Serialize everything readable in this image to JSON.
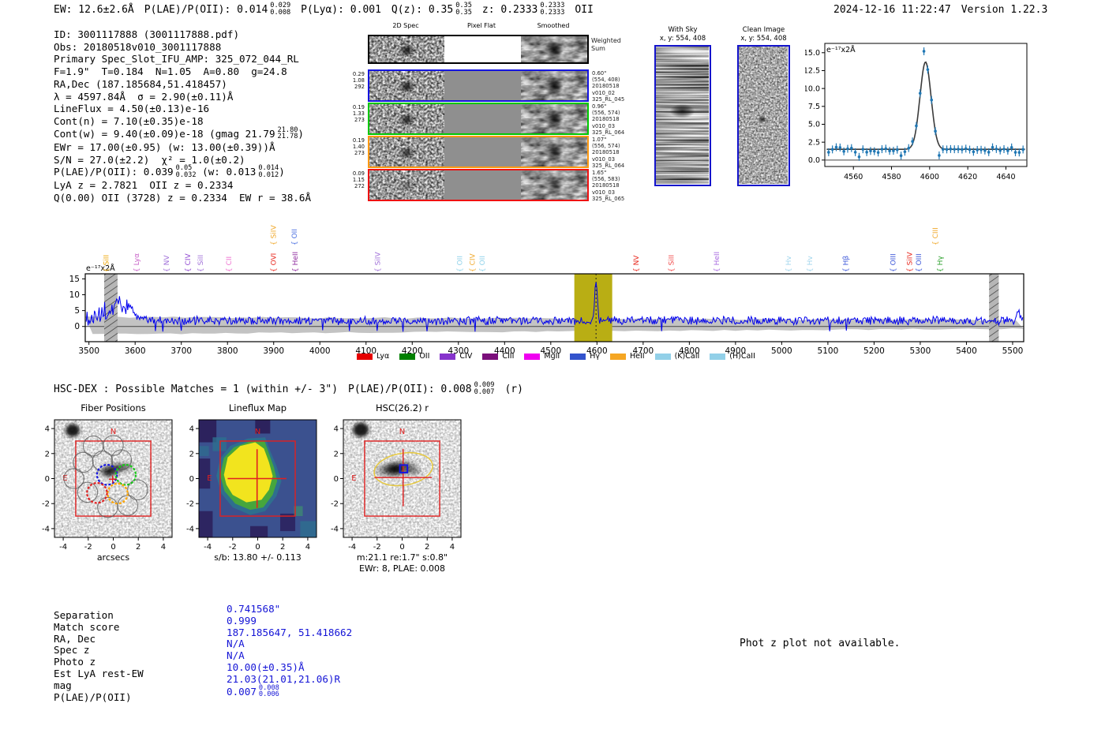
{
  "meta": {
    "datetime": "2024-12-16 11:22:47",
    "version_label": "Version 1.22.3"
  },
  "header": {
    "segments": [
      {
        "t": "EW: 12.6±2.6Å"
      },
      {
        "t": "P(LAE)/P(OII): 0.014",
        "sup": "0.029",
        "sub": "0.008"
      },
      {
        "t": "P(Lyα): 0.001"
      },
      {
        "t": "Q(z): 0.35",
        "sup": "0.35",
        "sub": "0.35"
      },
      {
        "t": "z: 0.2333",
        "sup": "0.2333",
        "sub": "0.2333"
      },
      {
        "t": "OII"
      }
    ]
  },
  "info_block": {
    "lines": [
      [
        {
          "t": "ID: 3001117888 (3001117888.pdf)"
        }
      ],
      [
        {
          "t": "Obs: 20180518v010_3001117888"
        }
      ],
      [
        {
          "t": "Primary Spec_Slot_IFU_AMP: 325_072_044_RL"
        }
      ],
      [
        {
          "t": "F=1.9\"  T=0.184  N=1.05  A=0.80  g=24.8"
        }
      ],
      [
        {
          "t": "RA,Dec (187.185684,51.418457)"
        }
      ],
      [
        {
          "t": "λ = 4597.84Å  σ = 2.90(±0.11)Å"
        }
      ],
      [
        {
          "t": "LineFlux = 4.50(±0.13)e-16"
        }
      ],
      [
        {
          "t": "Cont(n) = 7.10(±0.35)e-18"
        }
      ],
      [
        {
          "t": "Cont(w) = 9.40(±0.09)e-18 (gmag 21.79",
          "sup": "21.80",
          "sub": "21.78"
        },
        {
          "t": ")"
        }
      ],
      [
        {
          "t": "EWr = 17.00(±0.95) (w: 13.00(±0.39))Å"
        }
      ],
      [
        {
          "t": "S/N = 27.0(±2.2)  χ² = 1.0(±0.2)"
        }
      ],
      [
        {
          "t": "P(LAE)/P(OII): 0.039",
          "sup": "0.05",
          "sub": "0.032"
        },
        {
          "t": " (w: 0.013",
          "sup": "0.014",
          "sub": "0.012"
        },
        {
          "t": ")"
        }
      ],
      [
        {
          "t": "LyA z = 2.7821  OII z = 0.2334"
        }
      ],
      [
        {
          "t": "Q(0.00) OII (3728) z = 0.2334  EW r = 38.6Å"
        }
      ]
    ]
  },
  "spec2d": {
    "titles": [
      "2D Spec",
      "Pixel Flat",
      "Smoothed"
    ],
    "weighted_sum_label": "Weighted\nSum",
    "rows": [
      {
        "border": "#000000",
        "left": "",
        "right": "",
        "blob": 0.9,
        "blob_sm": 0.95,
        "flat": "#ffffff"
      },
      {
        "border": "#1414e0",
        "left": "0.29\n1.08\n292",
        "right": "0.60\"\n(554, 408)\n20180518\nv010_02\n325_RL_045",
        "blob": 0.9,
        "blob_sm": 0.95,
        "flat": "#8f8f8f"
      },
      {
        "border": "#00c800",
        "left": "0.19\n1.33\n273",
        "right": "0.96\"\n(556, 574)\n20180518\nv010_03\n325_RL_064",
        "blob": 0.85,
        "blob_sm": 0.9,
        "flat": "#8f8f8f"
      },
      {
        "border": "#ff9912",
        "left": "0.19\n1.40\n273",
        "right": "1.07\"\n(556, 574)\n20180518\nv010_03\n325_RL_064",
        "blob": 0.75,
        "blob_sm": 0.8,
        "flat": "#8f8f8f"
      },
      {
        "border": "#ee1111",
        "left": "0.09\n1.15\n272",
        "right": "1.65\"\n(556, 583)\n20180518\nv010_03\n325_RL_065",
        "blob": 0.35,
        "blob_sm": 0.55,
        "flat": "#8f8f8f"
      }
    ]
  },
  "sky_panels": {
    "with_sky": {
      "title": "With Sky",
      "subtitle": "x, y: 554, 408"
    },
    "clean": {
      "title": "Clean Image",
      "subtitle": "x, y: 554, 408"
    }
  },
  "hsc_dex": {
    "segments": [
      {
        "t": "HSC-DEX : Possible Matches = 1 (within +/- 3\")"
      },
      {
        "t": "P(LAE)/P(OII): 0.008",
        "sup": "0.009",
        "sub": "0.007"
      },
      {
        "t": "(r)"
      }
    ]
  },
  "spectrum_legend": [
    {
      "label": "Lyα",
      "color": "#e60000"
    },
    {
      "label": "OII",
      "color": "#008000"
    },
    {
      "label": "CIV",
      "color": "#8633cc"
    },
    {
      "label": "CIII",
      "color": "#7b0f7b"
    },
    {
      "label": "MgII",
      "color": "#f000f0"
    },
    {
      "label": "Hγ",
      "color": "#3353cc"
    },
    {
      "label": "HeII",
      "color": "#f5a623"
    },
    {
      "label": "(K)CaII",
      "color": "#92d0e8"
    },
    {
      "label": "(H)CaII",
      "color": "#92d0e8"
    }
  ],
  "match_table": {
    "rows": [
      {
        "label": "Separation",
        "value": "0.741568\""
      },
      {
        "label": "Match score",
        "value": "0.999"
      },
      {
        "label": "RA, Dec",
        "value": "187.185647, 51.418662"
      },
      {
        "label": "Spec z",
        "value": "N/A"
      },
      {
        "label": "Photo z",
        "value": "N/A"
      },
      {
        "label": "Est LyA rest-EW",
        "value": "10.00(±0.35)Å"
      },
      {
        "label": "mag",
        "value": "21.03(21.01,21.06)R"
      },
      {
        "label": "P(LAE)/P(OII)",
        "value": "0.007",
        "sup": "0.008",
        "sub": "0.006"
      }
    ]
  },
  "footer_note": "Phot z plot not available.",
  "chart_data": [
    {
      "id": "line_fit",
      "type": "scatter+line",
      "unit_label": "e⁻¹⁷x2Å",
      "xlim": [
        4545,
        4651
      ],
      "ylim": [
        -0.9,
        16.3
      ],
      "x_ticks": [
        4560,
        4580,
        4600,
        4620,
        4640
      ],
      "y_ticks": [
        0.0,
        2.5,
        5.0,
        7.5,
        10.0,
        12.5,
        15.0
      ],
      "fit": {
        "center": 4597.84,
        "sigma": 2.9,
        "amplitude": 12.2,
        "baseline": 1.5
      },
      "points": {
        "start": 4547,
        "end": 4649,
        "step": 2,
        "baseline": 1.5,
        "noise": 0.45,
        "errorbar": 0.55
      },
      "outliers": [
        [
          4563,
          0.45
        ],
        [
          4585,
          0.62
        ],
        [
          4605,
          0.65
        ],
        [
          4597,
          15.2
        ]
      ],
      "colors": {
        "points": "#1f77b4",
        "fit": "#3a3a3a"
      }
    },
    {
      "id": "full_spectrum",
      "type": "line",
      "unit_label": "e⁻¹⁷x2Å",
      "xlim": [
        3492,
        5524
      ],
      "ylim": [
        -4.8,
        16.6
      ],
      "x_ticks": [
        3500,
        3600,
        3700,
        3800,
        3900,
        4000,
        4100,
        4200,
        4300,
        4400,
        4500,
        4600,
        4700,
        4800,
        4900,
        5000,
        5100,
        5200,
        5300,
        5400,
        5500
      ],
      "y_ticks": [
        0,
        5,
        10,
        15
      ],
      "baseline": 1.8,
      "emission_peak": {
        "center": 4598,
        "height": 13.5,
        "sigma": 3.0
      },
      "blue_bump": {
        "center": 3568,
        "height": 5.0,
        "sigma": 26
      },
      "edge_spike": {
        "center": 5512,
        "height": 2.8,
        "sigma": 4
      },
      "highlight_band": [
        4551,
        4633
      ],
      "masked_bands": [
        [
          3533,
          3562
        ],
        [
          5449,
          5470
        ]
      ],
      "dashed_line_x": 4598,
      "colors": {
        "line": "#0000ee",
        "band": "#b9ae14",
        "error_fill": "#c3c3c3",
        "mask_line": "#2a2a2a",
        "mask_bg": "#b0b0b0"
      },
      "markers": [
        {
          "label": "SiII",
          "color": "#eda400",
          "x": 3542,
          "row": 0
        },
        {
          "label": "Lyα",
          "color": "#c65dc6",
          "x": 3608,
          "row": 0
        },
        {
          "label": "NV",
          "color": "#a070d8",
          "x": 3673,
          "row": 0
        },
        {
          "label": "CIV",
          "color": "#8e44d0",
          "x": 3719,
          "row": 0
        },
        {
          "label": "SiII",
          "color": "#a070d8",
          "x": 3747,
          "row": 0
        },
        {
          "label": "CII",
          "color": "#ef6fd0",
          "x": 3808,
          "row": 0
        },
        {
          "label": "OVI",
          "color": "#e8281e",
          "x": 3905,
          "row": 0
        },
        {
          "label": "HeII",
          "color": "#8e2a9e",
          "x": 3952,
          "row": 0
        },
        {
          "label": "SiIV",
          "color": "#f0a82a",
          "x": 3905,
          "row": 1
        },
        {
          "label": "OII",
          "color": "#4a6fe0",
          "x": 3950,
          "row": 1
        },
        {
          "label": "SiIV",
          "color": "#a070d8",
          "x": 4130,
          "row": 0
        },
        {
          "label": "OII",
          "color": "#8fd2ea",
          "x": 4308,
          "row": 0
        },
        {
          "label": "CIV",
          "color": "#f0a82a",
          "x": 4335,
          "row": 0
        },
        {
          "label": "OII",
          "color": "#8fd2ea",
          "x": 4357,
          "row": 0
        },
        {
          "label": "NV",
          "color": "#e8281e",
          "x": 4690,
          "row": 0
        },
        {
          "label": "SiII",
          "color": "#f04848",
          "x": 4766,
          "row": 0
        },
        {
          "label": "HeII",
          "color": "#a86ae0",
          "x": 4864,
          "row": 0
        },
        {
          "label": "Hv",
          "color": "#9fd4ec",
          "x": 5020,
          "row": 0
        },
        {
          "label": "Hv",
          "color": "#9fd4ec",
          "x": 5066,
          "row": 0
        },
        {
          "label": "Hβ",
          "color": "#3a55d8",
          "x": 5144,
          "row": 0
        },
        {
          "label": "OIII",
          "color": "#3a55d8",
          "x": 5246,
          "row": 0
        },
        {
          "label": "SiIV",
          "color": "#e8281e",
          "x": 5282,
          "row": 0
        },
        {
          "label": "OIII",
          "color": "#3a55d8",
          "x": 5302,
          "row": 0
        },
        {
          "label": "CIII",
          "color": "#f0a82a",
          "x": 5338,
          "row": 1
        },
        {
          "label": "Hγ",
          "color": "#2ca02c",
          "x": 5348,
          "row": 0
        }
      ]
    },
    {
      "id": "fiber_positions",
      "type": "image-overlay",
      "title": "Fiber Positions",
      "xlabel": "arcsecs",
      "xlim": [
        -4.7,
        4.7
      ],
      "x_ticks": [
        -4,
        -2,
        0,
        2,
        4
      ],
      "y_ticks": [
        -4,
        -2,
        0,
        2,
        4
      ],
      "compass": {
        "n": "N",
        "e": "E"
      },
      "box": [
        -3,
        3
      ],
      "fiber_radius": 0.8,
      "fibers_gray": [
        [
          -1.6,
          2.6
        ],
        [
          0.0,
          2.65
        ],
        [
          -2.4,
          1.3
        ],
        [
          -0.85,
          1.4
        ],
        [
          0.65,
          1.5
        ],
        [
          -3.15,
          0.0
        ],
        [
          -2.05,
          -1.1
        ],
        [
          1.95,
          -0.9
        ],
        [
          1.15,
          -2.15
        ],
        [
          -0.45,
          -2.3
        ]
      ],
      "fibers_colored": [
        {
          "x": -0.5,
          "y": 0.3,
          "color": "#1515e0"
        },
        {
          "x": 1.0,
          "y": 0.3,
          "color": "#18c818"
        },
        {
          "x": 0.35,
          "y": -1.2,
          "color": "#ffa500"
        },
        {
          "x": -1.3,
          "y": -1.15,
          "color": "#e02020"
        }
      ]
    },
    {
      "id": "lineflux_map",
      "type": "heatmap",
      "title": "Lineflux Map",
      "xlabel": "s/b: 13.80 +/- 0.113",
      "xlim": [
        -4.7,
        4.7
      ],
      "x_ticks": [
        -4,
        -2,
        0,
        2,
        4
      ],
      "y_ticks": [
        -4,
        -2,
        0,
        2,
        4
      ],
      "compass": {
        "n": "N",
        "e": "E"
      },
      "box": [
        -3,
        3
      ],
      "crosshair": {
        "x": -0.05,
        "y": 0.0,
        "half": 2.35
      },
      "colors": {
        "bg": "#3b518f",
        "dark": "#2a1a55",
        "teal": "#2e6f8e",
        "green": "#46a63c",
        "yellow": "#f2e41e"
      }
    },
    {
      "id": "hsc_cutout",
      "type": "image-overlay",
      "title": "HSC(26.2) r",
      "xlabel": "m:21.1 re:1.7\" s:0.8\"",
      "xlabel2": "EWr: 8, PLAE: 0.008",
      "xlim": [
        -4.7,
        4.7
      ],
      "x_ticks": [
        -4,
        -2,
        0,
        2,
        4
      ],
      "y_ticks": [
        -4,
        -2,
        0,
        2,
        4
      ],
      "compass": {
        "n": "N",
        "e": "E"
      },
      "box": [
        -3,
        3
      ],
      "ellipse": {
        "cx": 0.1,
        "cy": 0.75,
        "rx": 2.35,
        "ry": 1.28,
        "angle": -9,
        "color": "#e6c83c"
      },
      "marker_box": {
        "cx": 0.12,
        "cy": 0.78,
        "half": 0.3,
        "color": "#1515e0"
      },
      "crosshair": {
        "x": 0.08,
        "y": 0.08,
        "half": 2.3
      }
    }
  ]
}
